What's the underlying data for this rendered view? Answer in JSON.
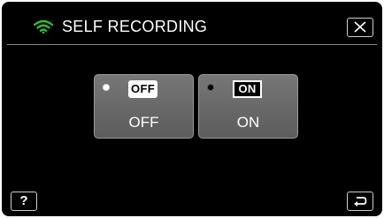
{
  "header": {
    "title": "SELF RECORDING",
    "wifi_icon": "wifi-icon",
    "close_icon": "close-icon",
    "accent_color": "#2fbf3a"
  },
  "options": [
    {
      "badge": "OFF",
      "label": "OFF",
      "selected": true
    },
    {
      "badge": "ON",
      "label": "ON",
      "selected": false
    }
  ],
  "footer": {
    "help_label": "?",
    "back_icon": "return-arrow-icon"
  }
}
